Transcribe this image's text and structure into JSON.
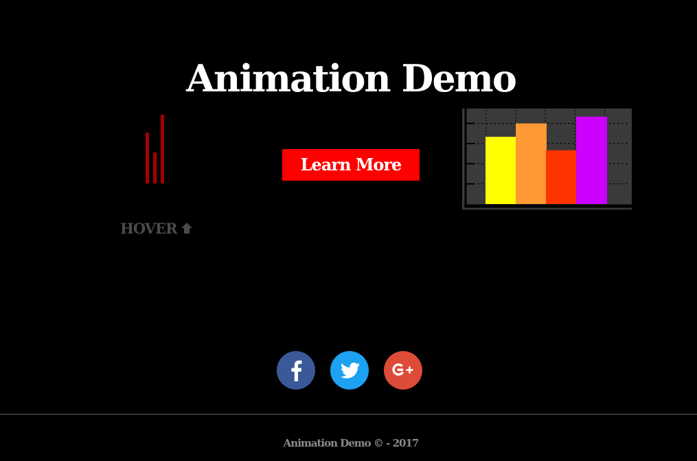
{
  "header": {
    "title": "Animation Demo"
  },
  "hover_widget": {
    "label": "HOVER",
    "arrow_icon": "arrow-up-icon",
    "bar_color": "#a50000",
    "bar_levels": [
      0.74,
      0.45,
      1.0
    ]
  },
  "cta": {
    "label": "Learn More",
    "color": "#ff0000"
  },
  "chart_data": {
    "type": "bar",
    "categories": [
      "",
      "",
      "",
      ""
    ],
    "values": [
      100,
      120,
      80,
      130
    ],
    "colors": [
      "#ffff00",
      "#ff9933",
      "#ff3300",
      "#cc00ff"
    ],
    "ylim": [
      0,
      140
    ],
    "grid": true,
    "title": "",
    "xlabel": "",
    "ylabel": "",
    "background": "#3a3a3a"
  },
  "social": [
    {
      "name": "facebook",
      "icon": "facebook-icon",
      "color": "#3b5998"
    },
    {
      "name": "twitter",
      "icon": "twitter-icon",
      "color": "#1da1f2"
    },
    {
      "name": "google-plus",
      "icon": "google-plus-icon",
      "color": "#dd4b39"
    }
  ],
  "footer": {
    "text": "Animation Demo © - 2017"
  }
}
